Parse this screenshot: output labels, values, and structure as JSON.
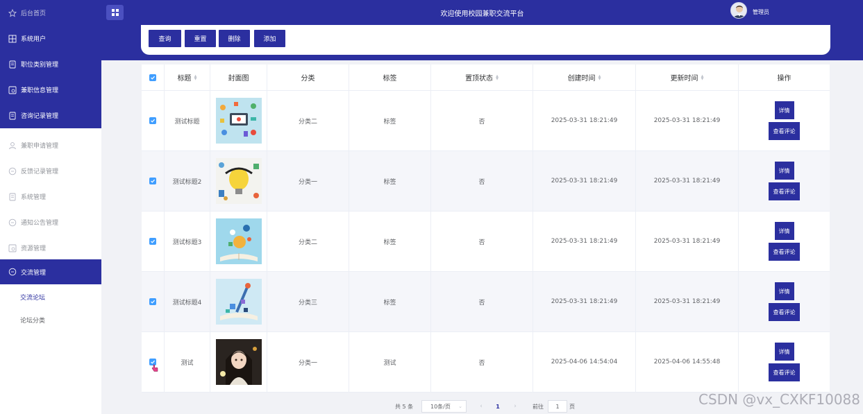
{
  "header": {
    "title": "欢迎使用校园兼职交流平台",
    "admin": "管理员"
  },
  "toolbar": {
    "query": "查询",
    "reset": "重置",
    "delete": "删除",
    "add": "添加"
  },
  "sidebar": {
    "items": [
      {
        "label": "后台首页",
        "icon": "star-icon"
      },
      {
        "label": "系统用户",
        "icon": "grid-icon"
      },
      {
        "label": "职位类别管理",
        "icon": "doc-icon"
      },
      {
        "label": "兼职信息管理",
        "icon": "chart-icon"
      },
      {
        "label": "咨询记录管理",
        "icon": "doc-icon"
      },
      {
        "label": "兼职申请管理",
        "icon": "user-icon"
      },
      {
        "label": "反馈记录管理",
        "icon": "chat-icon"
      },
      {
        "label": "系统管理",
        "icon": "doc-icon"
      },
      {
        "label": "通知公告管理",
        "icon": "chat-icon"
      },
      {
        "label": "资源管理",
        "icon": "chart-icon"
      },
      {
        "label": "交流管理",
        "icon": "chat-icon"
      }
    ],
    "sub": [
      {
        "label": "交流论坛"
      },
      {
        "label": "论坛分类"
      }
    ]
  },
  "table": {
    "headers": {
      "title": "标题",
      "cover": "封面图",
      "category": "分类",
      "tag": "标签",
      "top": "置顶状态",
      "created": "创建时间",
      "updated": "更新时间",
      "ops": "操作"
    },
    "detail_label": "详情",
    "comment_label": "查看评论",
    "rows": [
      {
        "title": "测试标题",
        "category": "分类二",
        "tag": "标签",
        "top": "否",
        "created": "2025-03-31 18:21:49",
        "updated": "2025-03-31 18:21:49"
      },
      {
        "title": "测试标题2",
        "category": "分类一",
        "tag": "标签",
        "top": "否",
        "created": "2025-03-31 18:21:49",
        "updated": "2025-03-31 18:21:49"
      },
      {
        "title": "测试标题3",
        "category": "分类二",
        "tag": "标签",
        "top": "否",
        "created": "2025-03-31 18:21:49",
        "updated": "2025-03-31 18:21:49"
      },
      {
        "title": "测试标题4",
        "category": "分类三",
        "tag": "标签",
        "top": "否",
        "created": "2025-03-31 18:21:49",
        "updated": "2025-03-31 18:21:49"
      },
      {
        "title": "测试",
        "category": "分类一",
        "tag": "测试",
        "top": "否",
        "created": "2025-04-06 14:54:04",
        "updated": "2025-04-06 14:55:48"
      }
    ]
  },
  "pagination": {
    "total": "共 5 条",
    "page_size": "10条/页",
    "current": "1",
    "goto_prefix": "前往",
    "goto_value": "1",
    "goto_suffix": "页"
  },
  "watermark": "CSDN @vx_CXKF10088",
  "colors": {
    "primary": "#2b2f9f",
    "checkbox": "#409eff"
  }
}
